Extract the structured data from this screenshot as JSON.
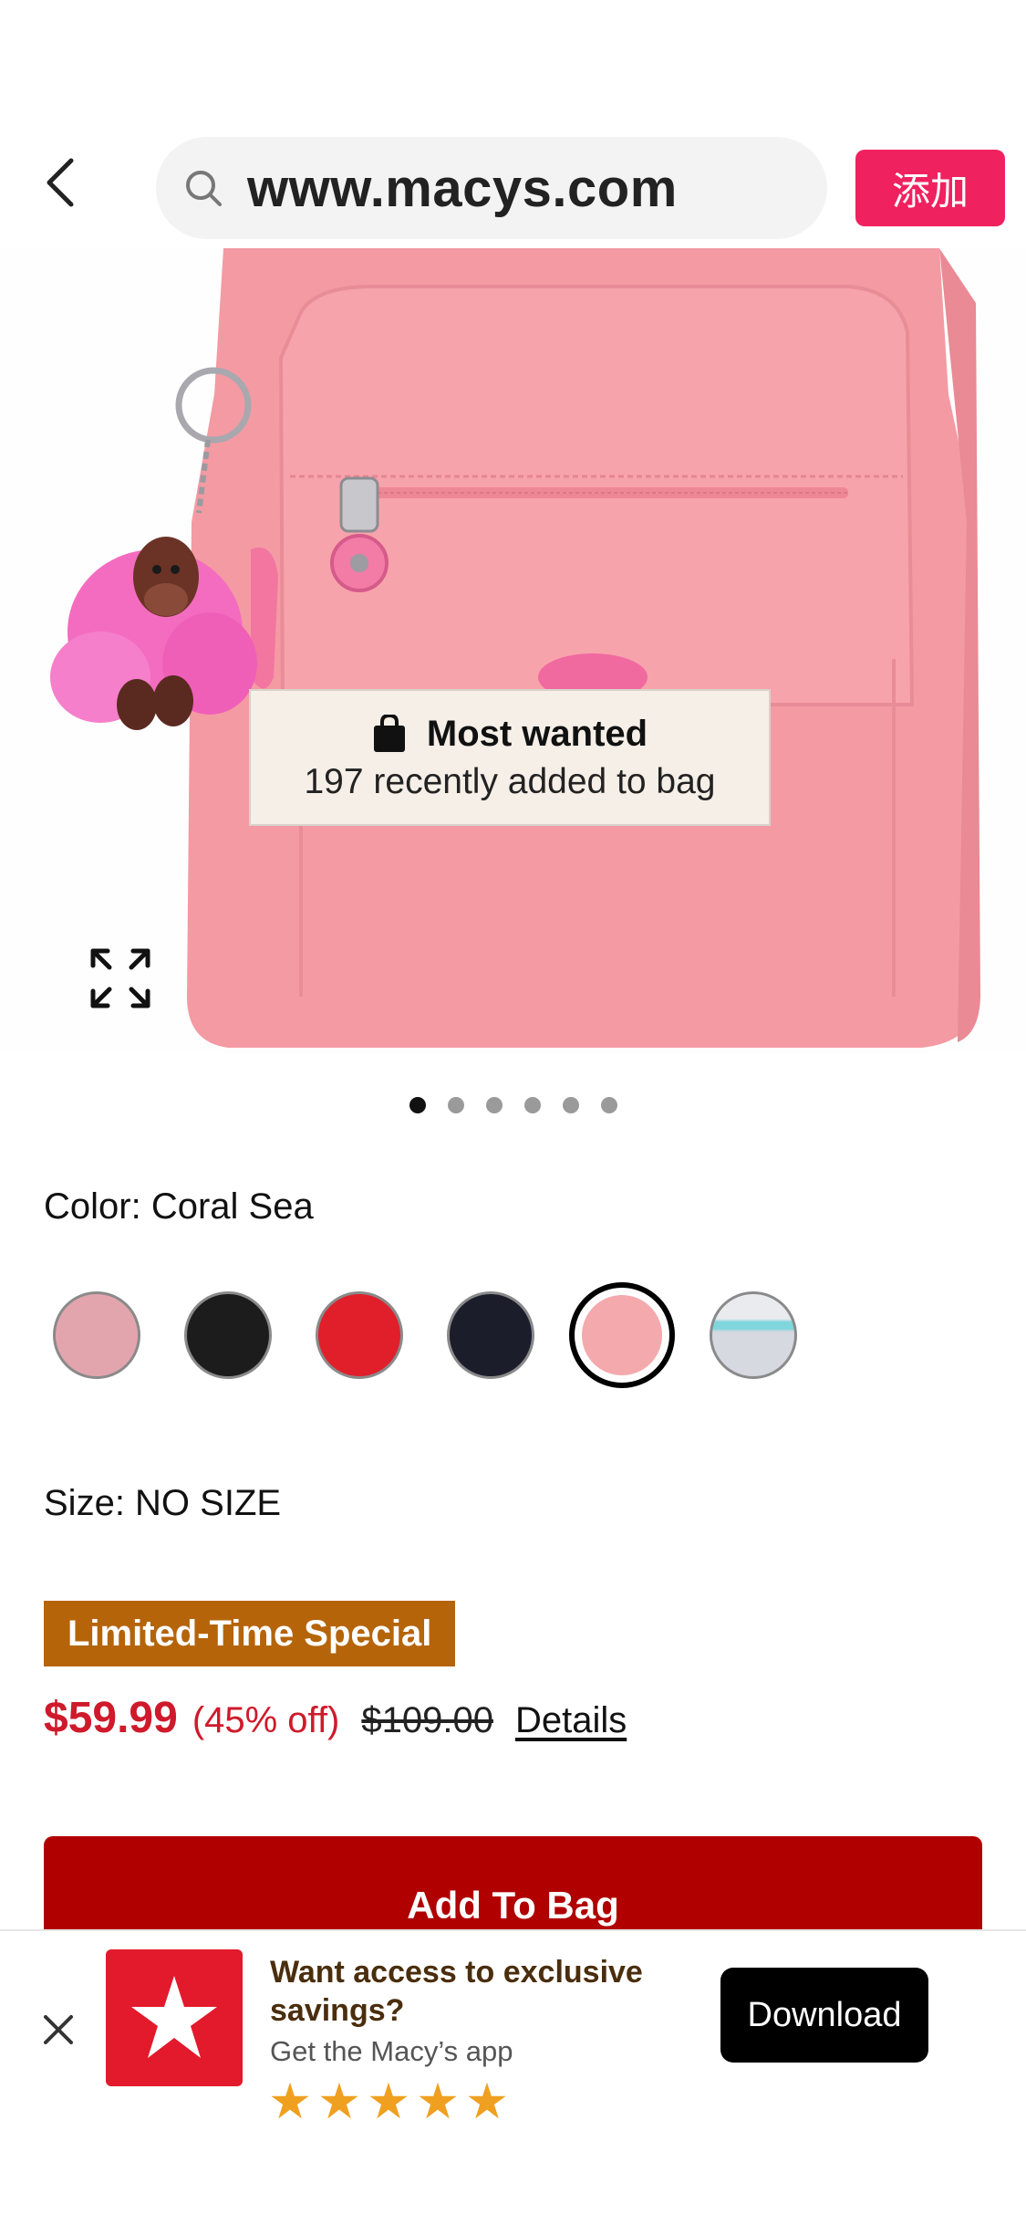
{
  "browser": {
    "url": "www.macys.com",
    "add_label": "添加"
  },
  "product": {
    "badge": {
      "title": "Most wanted",
      "subtitle": "197 recently added to bag"
    },
    "carousel_dots": 6,
    "carousel_active_index": 0,
    "color_label": "Color: Coral Sea",
    "swatches": [
      {
        "name": "pink",
        "color": "#e3a5ad"
      },
      {
        "name": "black",
        "color": "#1c1c1c"
      },
      {
        "name": "red",
        "color": "#e01f2b"
      },
      {
        "name": "navy",
        "color": "#1b1d2a"
      },
      {
        "name": "coral-sea",
        "color": "#f4a9ac",
        "selected": true
      },
      {
        "name": "light-blue-stripe",
        "color": "#dcdfe4"
      }
    ],
    "size_label": "Size: NO SIZE",
    "promo_label": "Limited-Time Special",
    "price_sale": "$59.99",
    "price_off": "(45% off)",
    "price_original": "$109.00",
    "details_label": "Details",
    "add_to_bag_label": "Add To Bag"
  },
  "app_banner": {
    "title": "Want access to exclusive savings?",
    "subtitle": "Get the Macy’s app",
    "rating_stars": 5,
    "download_label": "Download"
  },
  "colors": {
    "brand_red": "#e21a2c",
    "add_button": "#f0215f",
    "bag_button": "#b00000",
    "promo": "#b5640a",
    "sale_price": "#cf1a2b"
  }
}
